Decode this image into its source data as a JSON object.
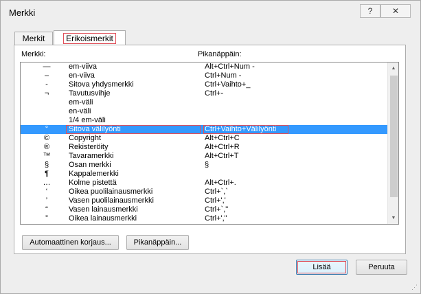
{
  "window": {
    "title": "Merkki",
    "help_label": "?",
    "close_label": "✕"
  },
  "tabs": [
    {
      "label": "Merkit",
      "active": false
    },
    {
      "label": "Erikoismerkit",
      "active": true
    }
  ],
  "list": {
    "col_char": "Merkki:",
    "col_shortcut": "Pikanäppäin:",
    "rows": [
      {
        "glyph": "—",
        "name": "em-viiva",
        "shortcut": "Alt+Ctrl+Num -"
      },
      {
        "glyph": "–",
        "name": "en-viiva",
        "shortcut": "Ctrl+Num -"
      },
      {
        "glyph": "-",
        "name": "Sitova yhdysmerkki",
        "shortcut": "Ctrl+Vaihto+_"
      },
      {
        "glyph": "¬",
        "name": "Tavutusvihje",
        "shortcut": "Ctrl+-"
      },
      {
        "glyph": "",
        "name": "em-väli",
        "shortcut": ""
      },
      {
        "glyph": "",
        "name": "en-väli",
        "shortcut": ""
      },
      {
        "glyph": "",
        "name": "1/4 em-väli",
        "shortcut": ""
      },
      {
        "glyph": "°",
        "name": "Sitova välilyönti",
        "shortcut": "Ctrl+Vaihto+Välilyönti",
        "selected": true
      },
      {
        "glyph": "©",
        "name": "Copyright",
        "shortcut": "Alt+Ctrl+C"
      },
      {
        "glyph": "®",
        "name": "Rekisteröity",
        "shortcut": "Alt+Ctrl+R"
      },
      {
        "glyph": "™",
        "name": "Tavaramerkki",
        "shortcut": "Alt+Ctrl+T"
      },
      {
        "glyph": "§",
        "name": "Osan merkki",
        "shortcut": "§"
      },
      {
        "glyph": "¶",
        "name": "Kappalemerkki",
        "shortcut": ""
      },
      {
        "glyph": "…",
        "name": "Kolme pistettä",
        "shortcut": "Alt+Ctrl+."
      },
      {
        "glyph": "‘",
        "name": "Oikea puolilainausmerkki",
        "shortcut": "Ctrl+`,`"
      },
      {
        "glyph": "’",
        "name": "Vasen puolilainausmerkki",
        "shortcut": "Ctrl+','"
      },
      {
        "glyph": "“",
        "name": "Vasen lainausmerkki",
        "shortcut": "Ctrl+`,\""
      },
      {
        "glyph": "”",
        "name": "Oikea lainausmerkki",
        "shortcut": "Ctrl+',\""
      }
    ]
  },
  "buttons": {
    "autocorrect": "Automaattinen korjaus...",
    "shortcut": "Pikanäppäin...",
    "insert": "Lisää",
    "cancel": "Peruuta"
  },
  "colors": {
    "selection": "#3399ff",
    "highlight_outline": "#e0505a"
  }
}
